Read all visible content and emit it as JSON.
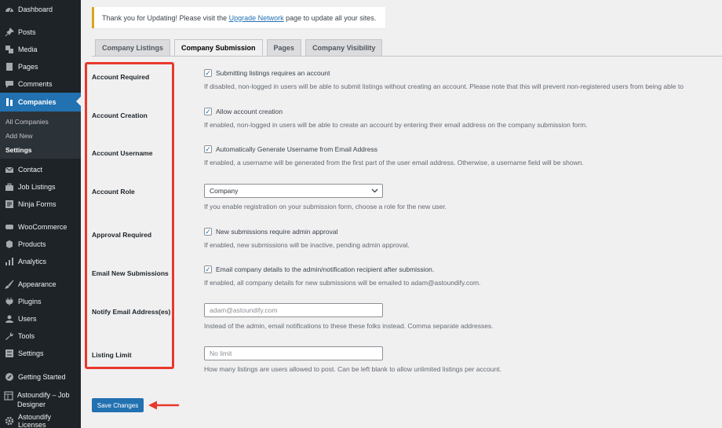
{
  "sidebar": {
    "items": [
      {
        "label": "Dashboard",
        "icon": "dashboard-icon"
      },
      {
        "label": "Posts",
        "icon": "pin-icon"
      },
      {
        "label": "Media",
        "icon": "media-icon"
      },
      {
        "label": "Pages",
        "icon": "pages-icon"
      },
      {
        "label": "Comments",
        "icon": "comment-icon"
      },
      {
        "label": "Companies",
        "icon": "building-icon"
      },
      {
        "label": "Contact",
        "icon": "mail-icon"
      },
      {
        "label": "Job Listings",
        "icon": "briefcase-icon"
      },
      {
        "label": "Ninja Forms",
        "icon": "form-icon"
      },
      {
        "label": "WooCommerce",
        "icon": "woo-icon"
      },
      {
        "label": "Products",
        "icon": "box-icon"
      },
      {
        "label": "Analytics",
        "icon": "bar-chart-icon"
      },
      {
        "label": "Appearance",
        "icon": "brush-icon"
      },
      {
        "label": "Plugins",
        "icon": "plug-icon"
      },
      {
        "label": "Users",
        "icon": "user-icon"
      },
      {
        "label": "Tools",
        "icon": "wrench-icon"
      },
      {
        "label": "Settings",
        "icon": "settings-icon"
      },
      {
        "label": "Getting Started",
        "icon": "rocket-icon"
      },
      {
        "label": "Astoundify – Job Designer",
        "icon": "layout-icon"
      },
      {
        "label": "Astoundify Licenses",
        "icon": "gear-icon"
      }
    ],
    "submenu": [
      "All Companies",
      "Add New",
      "Settings"
    ]
  },
  "notice": {
    "before": "Thank you for Updating! Please visit the ",
    "link": "Upgrade Network",
    "after": " page to update all your sites."
  },
  "tabs": [
    "Company Listings",
    "Company Submission",
    "Pages",
    "Company Visibility"
  ],
  "settings": {
    "account_required": {
      "label": "Account Required",
      "checkbox": "Submitting listings requires an account",
      "desc": "If disabled, non-logged in users will be able to submit listings without creating an account. Please note that this will prevent non-registered users from being able to"
    },
    "account_creation": {
      "label": "Account Creation",
      "checkbox": "Allow account creation",
      "desc": "If enabled, non-logged in users will be able to create an account by entering their email address on the company submission form."
    },
    "account_username": {
      "label": "Account Username",
      "checkbox": "Automatically Generate Username from Email Address",
      "desc": "If enabled, a username will be generated from the first part of the user email address. Otherwise, a username field will be shown."
    },
    "account_role": {
      "label": "Account Role",
      "value": "Company",
      "desc": "If you enable registration on your submission form, choose a role for the new user."
    },
    "approval_required": {
      "label": "Approval Required",
      "checkbox": "New submissions require admin approval",
      "desc": "If enabled, new submissions will be inactive, pending admin approval."
    },
    "email_new": {
      "label": "Email New Submissions",
      "checkbox": "Email company details to the admin/notification recipient after submission.",
      "desc": "If enabled, all company details for new submissions will be emailed to adam@astoundify.com."
    },
    "notify_email": {
      "label": "Notify Email Address(es)",
      "placeholder": "adam@astoundify.com",
      "desc": "Instead of the admin, email notifications to these these folks instead. Comma separate addresses."
    },
    "listing_limit": {
      "label": "Listing Limit",
      "placeholder": "No limit",
      "desc": "How many listings are users allowed to post. Can be left blank to allow unlimited listings per account."
    }
  },
  "save_label": "Save Changes",
  "colors": {
    "accent": "#2271b1",
    "highlight": "#e9382c",
    "sidebar": "#1d2327"
  }
}
